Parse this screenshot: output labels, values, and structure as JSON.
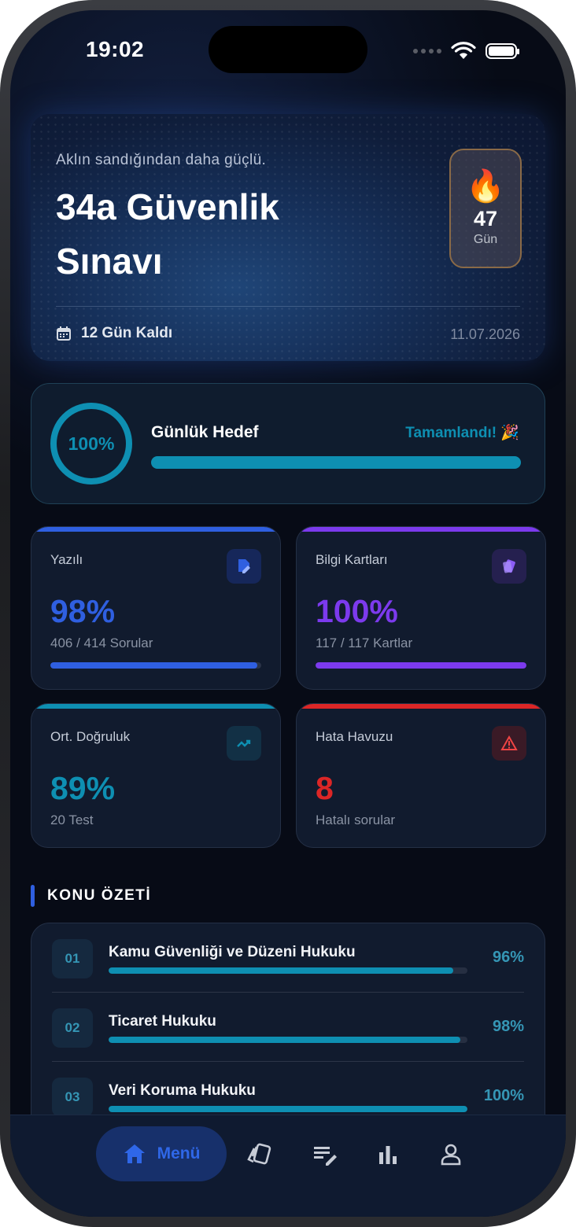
{
  "status": {
    "time": "19:02"
  },
  "hero": {
    "tagline": "Aklın sandığından daha güçlü.",
    "title": "34a Güvenlik Sınavı",
    "streak_count": "47",
    "streak_unit": "Gün",
    "remaining": "12 Gün Kaldı",
    "date": "11.07.2026"
  },
  "goal": {
    "percent_label": "100%",
    "progress": 1.0,
    "title": "Günlük Hedef",
    "status": "Tamamlandı! 🎉"
  },
  "stats": [
    {
      "label": "Yazılı",
      "value": "98%",
      "sub": "406 / 414 Sorular",
      "progress": 0.98,
      "color": "#2f5fe0",
      "icon": "edit-doc-icon"
    },
    {
      "label": "Bilgi Kartları",
      "value": "100%",
      "sub": "117 / 117 Kartlar",
      "progress": 1.0,
      "color": "#7c3aed",
      "icon": "cards-icon"
    },
    {
      "label": "Ort. Doğruluk",
      "value": "89%",
      "sub": "20 Test",
      "color": "#0e8fb2",
      "icon": "trending-up-icon"
    },
    {
      "label": "Hata Havuzu",
      "value": "8",
      "sub": "Hatalı sorular",
      "color": "#dc2626",
      "icon": "warning-icon"
    }
  ],
  "section_title": "KONU ÖZETİ",
  "topics": [
    {
      "no": "01",
      "name": "Kamu Güvenliği ve Düzeni Hukuku",
      "pct": "96%",
      "progress": 0.96
    },
    {
      "no": "02",
      "name": "Ticaret Hukuku",
      "pct": "98%",
      "progress": 0.98
    },
    {
      "no": "03",
      "name": "Veri Koruma Hukuku",
      "pct": "100%",
      "progress": 1.0
    }
  ],
  "nav": {
    "home_label": "Menü",
    "items": [
      "home-icon",
      "cards-icon",
      "notes-edit-icon",
      "stats-icon",
      "profile-icon"
    ]
  }
}
